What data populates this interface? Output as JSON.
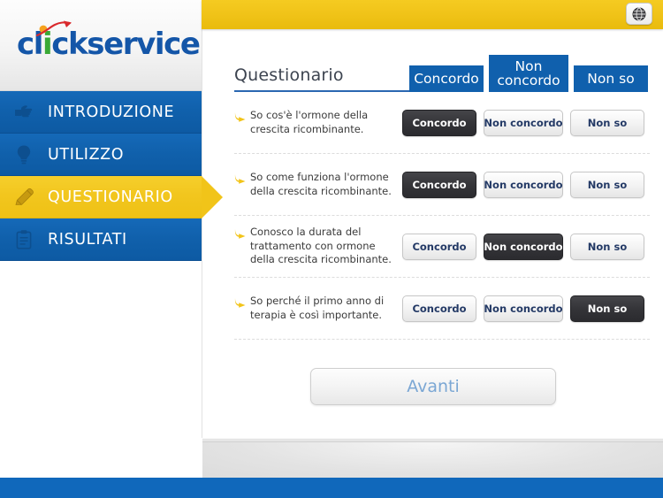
{
  "app": {
    "logo_text_part1": "cl",
    "logo_text_green": "i",
    "logo_text_part2": "ckservice",
    "logo_full": "clickservice"
  },
  "topbar": {
    "globe_icon": "globe-icon"
  },
  "sidebar": {
    "items": [
      {
        "label": "INTRODUZIONE",
        "icon": "pointing-hand-icon",
        "active": false
      },
      {
        "label": "UTILIZZO",
        "icon": "lightbulb-icon",
        "active": false
      },
      {
        "label": "QUESTIONARIO",
        "icon": "pencil-icon",
        "active": true
      },
      {
        "label": "RISULTATI",
        "icon": "clipboard-icon",
        "active": false
      }
    ]
  },
  "main": {
    "title": "Questionario",
    "columns": [
      {
        "label": "Concordo"
      },
      {
        "label": "Non concordo"
      },
      {
        "label": "Non so"
      }
    ],
    "questions": [
      {
        "text": "So cos'è l'ormone della crescita ricombinante.",
        "options": [
          "Concordo",
          "Non concordo",
          "Non so"
        ],
        "selected": 0
      },
      {
        "text": "So come funziona l'ormone della crescita ricombinante.",
        "options": [
          "Concordo",
          "Non concordo",
          "Non so"
        ],
        "selected": 0
      },
      {
        "text": "Conosco la durata del trattamento con ormone della crescita ricombinante.",
        "options": [
          "Concordo",
          "Non concordo",
          "Non so"
        ],
        "selected": 1
      },
      {
        "text": "So perché il primo anno di terapia è così importante.",
        "options": [
          "Concordo",
          "Non concordo",
          "Non so"
        ],
        "selected": 2
      }
    ],
    "next_button_label": "Avanti"
  },
  "colors": {
    "brand_blue": "#1060ad",
    "brand_yellow": "#f0c318",
    "logo_blue": "#1456a8",
    "logo_green": "#3aa935",
    "selected_dark": "#343438",
    "option_text_blue": "#243a66",
    "avanti_text": "#7ba7d4",
    "bottom_bar_blue": "#1068bb"
  }
}
